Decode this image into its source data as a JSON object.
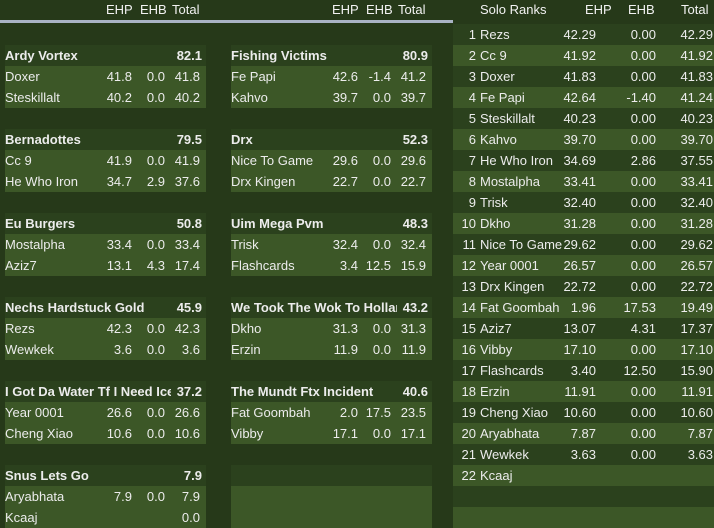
{
  "headers": {
    "ehp": "EHP",
    "ehb": "EHB",
    "total": "Total",
    "solo_title": "Solo Ranks"
  },
  "teams": [
    {
      "name": "Ardy Vortex",
      "total": "82.1",
      "members": [
        {
          "name": "Doxer",
          "ehp": "41.8",
          "ehb": "0.0",
          "total": "41.8"
        },
        {
          "name": "Steskillalt",
          "ehp": "40.2",
          "ehb": "0.0",
          "total": "40.2"
        }
      ]
    },
    {
      "name": "Fishing Victims",
      "total": "80.9",
      "members": [
        {
          "name": "Fe Papi",
          "ehp": "42.6",
          "ehb": "-1.4",
          "total": "41.2"
        },
        {
          "name": "Kahvo",
          "ehp": "39.7",
          "ehb": "0.0",
          "total": "39.7"
        }
      ]
    },
    {
      "name": "Bernadottes",
      "total": "79.5",
      "members": [
        {
          "name": "Cc 9",
          "ehp": "41.9",
          "ehb": "0.0",
          "total": "41.9"
        },
        {
          "name": "He Who Iron",
          "ehp": "34.7",
          "ehb": "2.9",
          "total": "37.6"
        }
      ]
    },
    {
      "name": "Drx",
      "total": "52.3",
      "members": [
        {
          "name": "Nice To Game",
          "ehp": "29.6",
          "ehb": "0.0",
          "total": "29.6"
        },
        {
          "name": "Drx Kingen",
          "ehp": "22.7",
          "ehb": "0.0",
          "total": "22.7"
        }
      ]
    },
    {
      "name": "Eu Burgers",
      "total": "50.8",
      "members": [
        {
          "name": "Mostalpha",
          "ehp": "33.4",
          "ehb": "0.0",
          "total": "33.4"
        },
        {
          "name": "Aziz7",
          "ehp": "13.1",
          "ehb": "4.3",
          "total": "17.4"
        }
      ]
    },
    {
      "name": "Uim Mega Pvm",
      "total": "48.3",
      "members": [
        {
          "name": "Trisk",
          "ehp": "32.4",
          "ehb": "0.0",
          "total": "32.4"
        },
        {
          "name": "Flashcards",
          "ehp": "3.4",
          "ehb": "12.5",
          "total": "15.9"
        }
      ]
    },
    {
      "name": "Nechs Hardstuck Gold",
      "total": "45.9",
      "members": [
        {
          "name": "Rezs",
          "ehp": "42.3",
          "ehb": "0.0",
          "total": "42.3"
        },
        {
          "name": "Wewkek",
          "ehp": "3.6",
          "ehb": "0.0",
          "total": "3.6"
        }
      ]
    },
    {
      "name": "We Took The Wok To Hollar",
      "total": "43.2",
      "members": [
        {
          "name": "Dkho",
          "ehp": "31.3",
          "ehb": "0.0",
          "total": "31.3"
        },
        {
          "name": "Erzin",
          "ehp": "11.9",
          "ehb": "0.0",
          "total": "11.9"
        }
      ]
    },
    {
      "name": "I Got Da Water Tf I Need Ice",
      "total": "37.2",
      "members": [
        {
          "name": "Year 0001",
          "ehp": "26.6",
          "ehb": "0.0",
          "total": "26.6"
        },
        {
          "name": "Cheng Xiao",
          "ehp": "10.6",
          "ehb": "0.0",
          "total": "10.6"
        }
      ]
    },
    {
      "name": "The Mundt Ftx Incident",
      "total": "40.6",
      "members": [
        {
          "name": "Fat Goombah",
          "ehp": "2.0",
          "ehb": "17.5",
          "total": "23.5"
        },
        {
          "name": "Vibby",
          "ehp": "17.1",
          "ehb": "0.0",
          "total": "17.1"
        }
      ]
    },
    {
      "name": "Snus Lets Go",
      "total": "7.9",
      "members": [
        {
          "name": "Aryabhata",
          "ehp": "7.9",
          "ehb": "0.0",
          "total": "7.9"
        },
        {
          "name": "Kcaaj",
          "ehp": "",
          "ehb": "",
          "total": "0.0"
        }
      ]
    },
    {
      "name": "",
      "total": "",
      "members": [
        {
          "name": "",
          "ehp": "",
          "ehb": "",
          "total": ""
        },
        {
          "name": "",
          "ehp": "",
          "ehb": "",
          "total": ""
        }
      ]
    }
  ],
  "solo": [
    {
      "rank": "1",
      "name": "Rezs",
      "ehp": "42.29",
      "ehb": "0.00",
      "total": "42.29"
    },
    {
      "rank": "2",
      "name": "Cc 9",
      "ehp": "41.92",
      "ehb": "0.00",
      "total": "41.92"
    },
    {
      "rank": "3",
      "name": "Doxer",
      "ehp": "41.83",
      "ehb": "0.00",
      "total": "41.83"
    },
    {
      "rank": "4",
      "name": "Fe Papi",
      "ehp": "42.64",
      "ehb": "-1.40",
      "total": "41.24"
    },
    {
      "rank": "5",
      "name": "Steskillalt",
      "ehp": "40.23",
      "ehb": "0.00",
      "total": "40.23"
    },
    {
      "rank": "6",
      "name": "Kahvo",
      "ehp": "39.70",
      "ehb": "0.00",
      "total": "39.70"
    },
    {
      "rank": "7",
      "name": "He Who Iron",
      "ehp": "34.69",
      "ehb": "2.86",
      "total": "37.55"
    },
    {
      "rank": "8",
      "name": "Mostalpha",
      "ehp": "33.41",
      "ehb": "0.00",
      "total": "33.41"
    },
    {
      "rank": "9",
      "name": "Trisk",
      "ehp": "32.40",
      "ehb": "0.00",
      "total": "32.40"
    },
    {
      "rank": "10",
      "name": "Dkho",
      "ehp": "31.28",
      "ehb": "0.00",
      "total": "31.28"
    },
    {
      "rank": "11",
      "name": "Nice To Game",
      "ehp": "29.62",
      "ehb": "0.00",
      "total": "29.62"
    },
    {
      "rank": "12",
      "name": "Year 0001",
      "ehp": "26.57",
      "ehb": "0.00",
      "total": "26.57"
    },
    {
      "rank": "13",
      "name": "Drx Kingen",
      "ehp": "22.72",
      "ehb": "0.00",
      "total": "22.72"
    },
    {
      "rank": "14",
      "name": "Fat Goombah",
      "ehp": "1.96",
      "ehb": "17.53",
      "total": "19.49"
    },
    {
      "rank": "15",
      "name": "Aziz7",
      "ehp": "13.07",
      "ehb": "4.31",
      "total": "17.37"
    },
    {
      "rank": "16",
      "name": "Vibby",
      "ehp": "17.10",
      "ehb": "0.00",
      "total": "17.10"
    },
    {
      "rank": "17",
      "name": "Flashcards",
      "ehp": "3.40",
      "ehb": "12.50",
      "total": "15.90"
    },
    {
      "rank": "18",
      "name": "Erzin",
      "ehp": "11.91",
      "ehb": "0.00",
      "total": "11.91"
    },
    {
      "rank": "19",
      "name": "Cheng Xiao",
      "ehp": "10.60",
      "ehb": "0.00",
      "total": "10.60"
    },
    {
      "rank": "20",
      "name": "Aryabhata",
      "ehp": "7.87",
      "ehb": "0.00",
      "total": "7.87"
    },
    {
      "rank": "21",
      "name": "Wewkek",
      "ehp": "3.63",
      "ehb": "0.00",
      "total": "3.63"
    },
    {
      "rank": "22",
      "name": "Kcaaj",
      "ehp": "",
      "ehb": "",
      "total": ""
    }
  ],
  "colors": {
    "background": "#263919",
    "row_dark": "#2b411d",
    "row_light": "#3c5727",
    "header_line": "#a9b3c4"
  }
}
